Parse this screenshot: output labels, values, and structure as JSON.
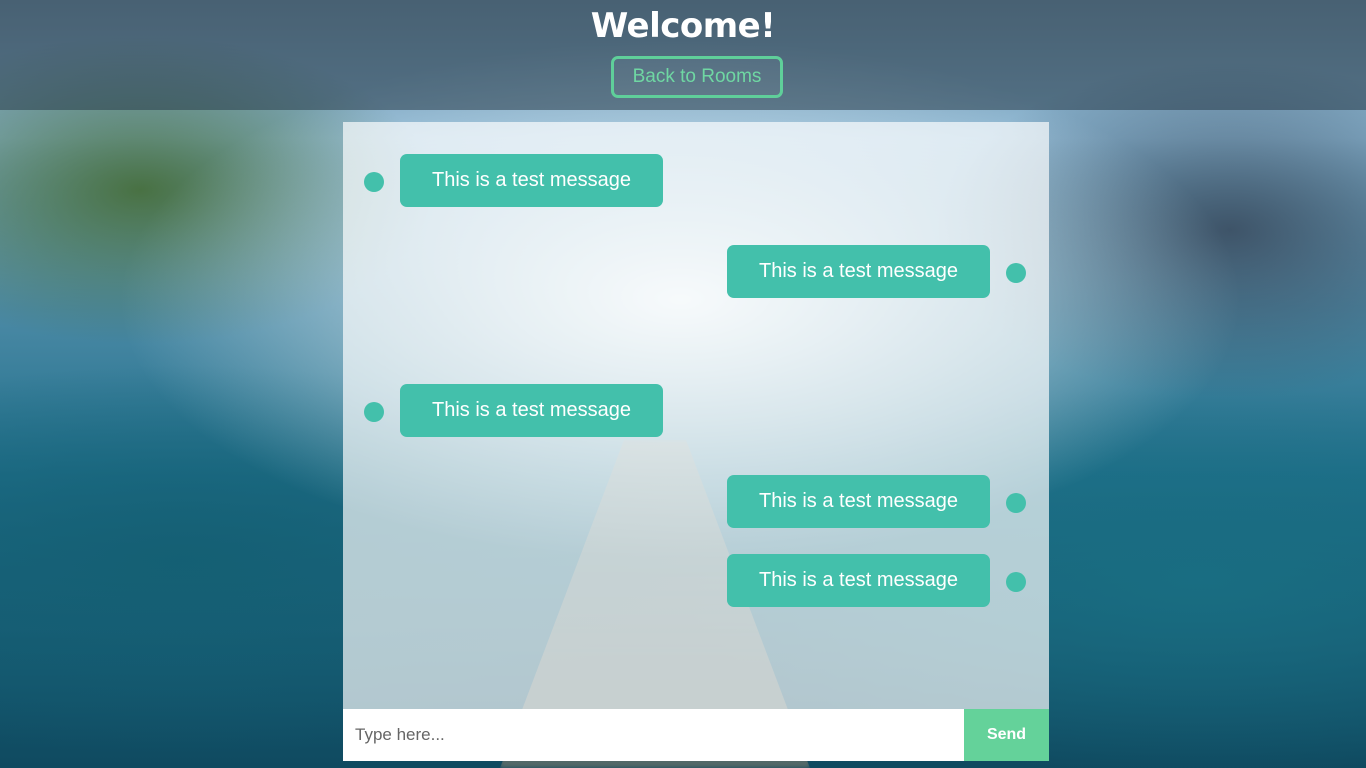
{
  "header": {
    "title": "Welcome!",
    "back_button_label": "Back to Rooms"
  },
  "chat": {
    "messages": [
      {
        "text": "This is a test message",
        "side": "left"
      },
      {
        "text": "This is a test message",
        "side": "right"
      },
      {
        "text": "This is a test message",
        "side": "left"
      },
      {
        "text": "This is a test message",
        "side": "right"
      },
      {
        "text": "This is a test message",
        "side": "right"
      }
    ]
  },
  "composer": {
    "input_value": "",
    "placeholder": "Type here...",
    "send_label": "Send"
  },
  "colors": {
    "accent": "#43c0ab",
    "send_button": "#64d29a",
    "back_button_border": "#5fcf9a"
  }
}
